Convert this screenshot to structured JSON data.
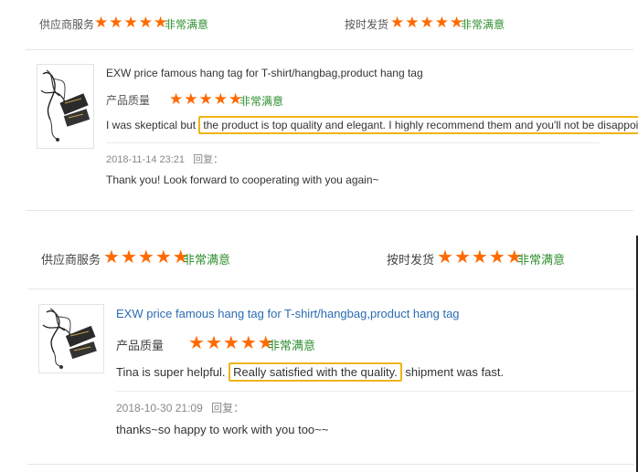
{
  "colors": {
    "star": "#ff6a00",
    "satisfied": "#2f8f2f",
    "highlight": "#f0b418",
    "link": "#2b6cb3"
  },
  "review1": {
    "supplier_service_label": "供应商服务",
    "on_time_delivery_label": "按时发货",
    "supplier_rating": 5,
    "delivery_rating": 5,
    "supplier_status": "非常满意",
    "delivery_status": "非常满意",
    "product_title": "EXW price famous hang tag for T-shirt/hangbag,product hang tag",
    "quality_label": "产品质量",
    "quality_rating": 5,
    "quality_status": "非常满意",
    "text_before": "I was skeptical but ",
    "text_highlight": "the product is top quality and elegant. I highly recommend them and you'll not be disappointed.",
    "text_after": "",
    "date": "2018-11-14 23:21",
    "reply_label": "回复：",
    "reply_text": "Thank you! Look forward to cooperating with you again~"
  },
  "review2": {
    "supplier_service_label": "供应商服务",
    "on_time_delivery_label": "按时发货",
    "supplier_rating": 5,
    "delivery_rating": 5,
    "supplier_status": "非常满意",
    "delivery_status": "非常满意",
    "product_title": "EXW price famous hang tag for T-shirt/hangbag,product hang tag",
    "quality_label": "产品质量",
    "quality_rating": 5,
    "quality_status": "非常满意",
    "text_before": "Tina is super helpful. ",
    "text_highlight": "Really satisfied with the quality.",
    "text_after": " shipment was fast.",
    "date": "2018-10-30 21:09",
    "reply_label": "回复：",
    "reply_text": "thanks~so happy to work with you too~~"
  }
}
